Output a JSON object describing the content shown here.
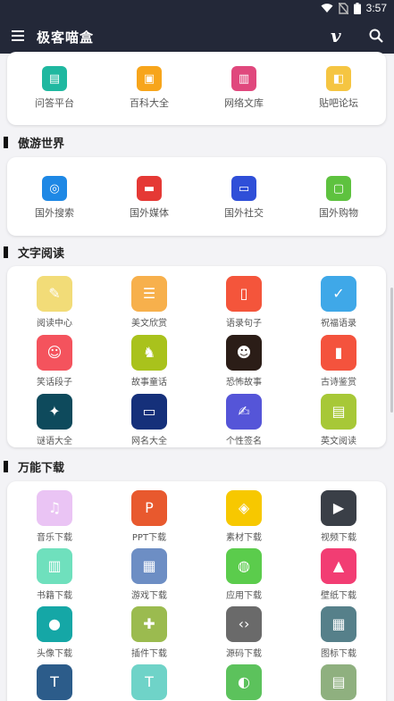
{
  "status": {
    "time": "3:57"
  },
  "header": {
    "title": "极客喵盒"
  },
  "cards": {
    "top": [
      {
        "label": "问答平台",
        "color": "#1fb8a0",
        "icon": "qa-icon"
      },
      {
        "label": "百科大全",
        "color": "#f7a51b",
        "icon": "encyclopedia-icon"
      },
      {
        "label": "网络文库",
        "color": "#e0487d",
        "icon": "library-icon"
      },
      {
        "label": "贴吧论坛",
        "color": "#f5c542",
        "icon": "forum-icon"
      }
    ],
    "overseas": {
      "title": "傲游世界",
      "items": [
        {
          "label": "国外搜索",
          "color": "#1e88e5",
          "icon": "search-globe-icon"
        },
        {
          "label": "国外媒体",
          "color": "#e53935",
          "icon": "media-icon"
        },
        {
          "label": "国外社交",
          "color": "#2f4fd8",
          "icon": "chat-icon"
        },
        {
          "label": "国外购物",
          "color": "#5ec23f",
          "icon": "shopping-bag-icon"
        }
      ]
    },
    "reading": {
      "title": "文字阅读",
      "items": [
        {
          "label": "阅读中心",
          "color": "#f2dc78",
          "icon": "read-note-icon"
        },
        {
          "label": "美文欣赏",
          "color": "#f7b04c",
          "icon": "article-icon"
        },
        {
          "label": "语录句子",
          "color": "#f4553b",
          "icon": "bookmark-icon"
        },
        {
          "label": "祝福语录",
          "color": "#3fa8e8",
          "icon": "thumbs-up-icon"
        },
        {
          "label": "笑话段子",
          "color": "#f4535d",
          "icon": "smile-icon"
        },
        {
          "label": "故事童话",
          "color": "#a9c21c",
          "icon": "story-icon"
        },
        {
          "label": "恐怖故事",
          "color": "#2b1d17",
          "icon": "devil-icon"
        },
        {
          "label": "古诗鉴赏",
          "color": "#f4533d",
          "icon": "poem-book-icon"
        },
        {
          "label": "谜语大全",
          "color": "#0e4a5c",
          "icon": "riddle-icon"
        },
        {
          "label": "网名大全",
          "color": "#15307a",
          "icon": "name-card-icon"
        },
        {
          "label": "个性签名",
          "color": "#5555d8",
          "icon": "signature-pen-icon"
        },
        {
          "label": "英文阅读",
          "color": "#a7c837",
          "icon": "english-icon"
        }
      ]
    },
    "download": {
      "title": "万能下载",
      "items": [
        {
          "label": "音乐下载",
          "color": "#eac4f4",
          "icon": "music-icon"
        },
        {
          "label": "PPT下载",
          "color": "#e8592e",
          "icon": "ppt-icon"
        },
        {
          "label": "素材下载",
          "color": "#f7c800",
          "icon": "layers-icon"
        },
        {
          "label": "视频下载",
          "color": "#3a3f47",
          "icon": "video-icon"
        },
        {
          "label": "书籍下载",
          "color": "#6fe0bd",
          "icon": "book-icon"
        },
        {
          "label": "游戏下载",
          "color": "#6d8ec4",
          "icon": "game-icon"
        },
        {
          "label": "应用下载",
          "color": "#5bcc4c",
          "icon": "app-bag-icon"
        },
        {
          "label": "壁纸下载",
          "color": "#f23d73",
          "icon": "wallpaper-icon"
        },
        {
          "label": "头像下载",
          "color": "#15a7a6",
          "icon": "avatar-icon"
        },
        {
          "label": "插件下载",
          "color": "#9bbb4f",
          "icon": "plugin-icon"
        },
        {
          "label": "源码下载",
          "color": "#6a6a6a",
          "icon": "code-icon"
        },
        {
          "label": "图标下载",
          "color": "#56808a",
          "icon": "grid-icon"
        },
        {
          "label": "",
          "color": "#2c5c8a",
          "icon": "font-icon"
        },
        {
          "label": "",
          "color": "#6fd3c8",
          "icon": "text-box-icon"
        },
        {
          "label": "",
          "color": "#5cc25c",
          "icon": "misc-icon"
        },
        {
          "label": "",
          "color": "#8fb07f",
          "icon": "printer-icon"
        }
      ]
    }
  }
}
